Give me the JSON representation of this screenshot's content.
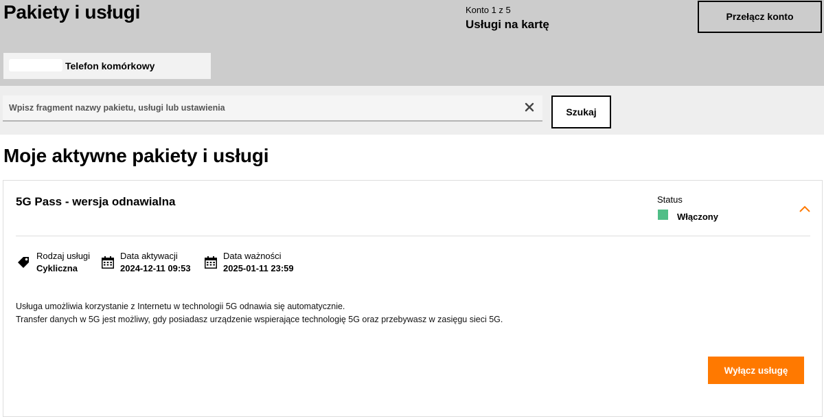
{
  "header": {
    "title": "Pakiety i usługi",
    "account_counter": "Konto 1 z 5",
    "account_name": "Usługi na kartę",
    "switch_account_label": "Przełącz konto",
    "phone_tab_label": "Telefon komórkowy"
  },
  "search": {
    "placeholder": "Wpisz fragment nazwy pakietu, usługi lub ustawienia",
    "value": "",
    "clear_icon": "close-icon",
    "button_label": "Szukaj"
  },
  "main": {
    "section_title": "Moje aktywne pakiety i usługi",
    "services": [
      {
        "name": "5G Pass - wersja odnawialna",
        "status_label": "Status",
        "status_value": "Włączony",
        "status_color": "#50be87",
        "details": [
          {
            "label": "Rodzaj usługi",
            "value": "Cykliczna",
            "icon": "tag-icon"
          },
          {
            "label": "Data aktywacji",
            "value": "2024-12-11 09:53",
            "icon": "calendar-icon"
          },
          {
            "label": "Data ważności",
            "value": "2025-01-11 23:59",
            "icon": "calendar-icon"
          }
        ],
        "description": [
          "Usługa umożliwia korzystanie z Internetu w technologii 5G odnawia się automatycznie.",
          "Transfer danych w 5G jest możliwy, gdy posiadasz urządzenie wspierające technologię 5G oraz przebywasz w zasięgu sieci 5G."
        ],
        "disable_label": "Wyłącz usługę"
      }
    ]
  },
  "colors": {
    "accent": "#ff7900",
    "header_bg": "#cccccc",
    "search_band_bg": "#eeeeee",
    "status_on": "#50be87"
  }
}
